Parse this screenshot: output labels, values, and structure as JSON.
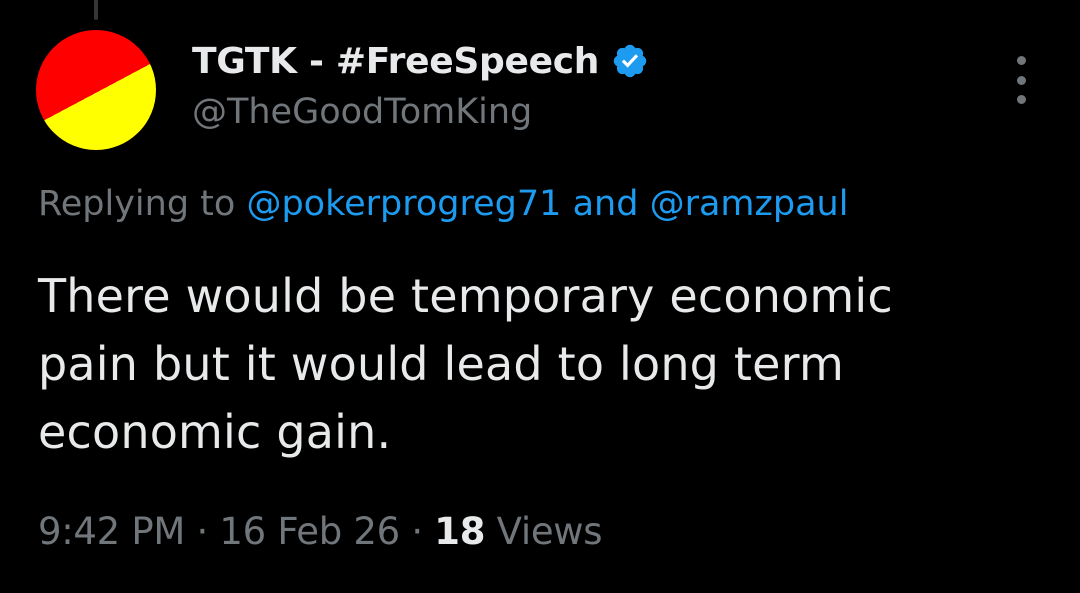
{
  "author": {
    "display_name": "TGTK - #FreeSpeech",
    "handle": "@TheGoodTomKing",
    "verified_icon": "verified-badge-icon",
    "avatar_colors": {
      "top": "#ff0000",
      "bottom": "#ffff00"
    }
  },
  "reply": {
    "prefix": "Replying to",
    "mention_1": "@pokerprogreg71",
    "conjunction": "and",
    "mention_2": "@ramzpaul"
  },
  "tweet": {
    "lines": [
      "There would be temporary economic",
      "pain but it would lead to long term",
      "economic gain."
    ]
  },
  "meta": {
    "time": "9:42 PM",
    "separator": "·",
    "date": "16 Feb 26",
    "views_count": "18",
    "views_label": "Views"
  },
  "colors": {
    "background": "#000000",
    "primary_text": "#e7e9ea",
    "secondary_text": "#71767b",
    "accent": "#1d9bf0"
  },
  "icons": {
    "more": "more-options-icon"
  }
}
